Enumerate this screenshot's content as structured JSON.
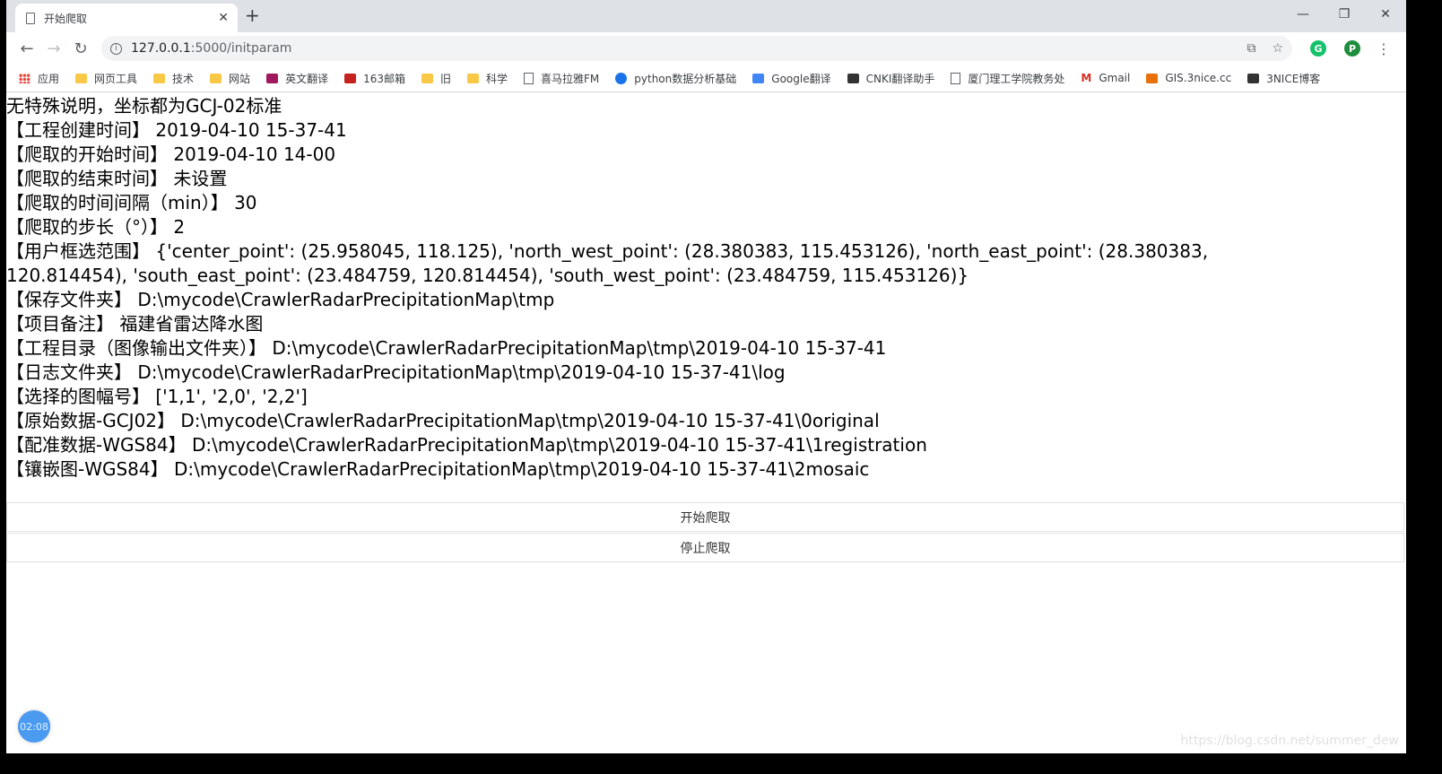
{
  "browser": {
    "tab_title": "开始爬取",
    "url_host": "127.0.0.1",
    "url_path": ":5000/initparam",
    "avatar_letter": "P",
    "ext_letter": "G"
  },
  "bookmarks": [
    {
      "label": "应用",
      "icon": "apps-icon"
    },
    {
      "label": "网页工具",
      "icon": "folder-icon"
    },
    {
      "label": "技术",
      "icon": "folder-icon"
    },
    {
      "label": "网站",
      "icon": "folder-icon"
    },
    {
      "label": "英文翻译",
      "icon": "translate-icon"
    },
    {
      "label": "163邮箱",
      "icon": "mail163-icon"
    },
    {
      "label": "旧",
      "icon": "folder-icon"
    },
    {
      "label": "科学",
      "icon": "folder-icon"
    },
    {
      "label": "喜马拉雅FM",
      "icon": "page-icon"
    },
    {
      "label": "python数据分析基础",
      "icon": "globe-icon"
    },
    {
      "label": "Google翻译",
      "icon": "google-translate-icon"
    },
    {
      "label": "CNKI翻译助手",
      "icon": "cnki-icon"
    },
    {
      "label": "厦门理工学院教务处",
      "icon": "page-icon"
    },
    {
      "label": "Gmail",
      "icon": "gmail-icon"
    },
    {
      "label": "GIS.3nice.cc",
      "icon": "gis-icon"
    },
    {
      "label": "3NICE博客",
      "icon": "blog-icon"
    }
  ],
  "info": {
    "note": "无特殊说明，坐标都为GCJ-02标准",
    "created": "【工程创建时间】 2019-04-10 15-37-41",
    "start": "【爬取的开始时间】 2019-04-10 14-00",
    "end": "【爬取的结束时间】 未设置",
    "interval": "【爬取的时间间隔（min）】 30",
    "step": "【爬取的步长（°）】 2",
    "extent": "【用户框选范围】 {'center_point': (25.958045, 118.125), 'north_west_point': (28.380383, 115.453126), 'north_east_point': (28.380383, 120.814454), 'south_east_point': (23.484759, 120.814454), 'south_west_point': (23.484759, 115.453126)}",
    "save_folder": "【保存文件夹】 D:\\mycode\\CrawlerRadarPrecipitationMap\\tmp",
    "remark": "【项目备注】 福建省雷达降水图",
    "project_dir": "【工程目录（图像输出文件夹）】 D:\\mycode\\CrawlerRadarPrecipitationMap\\tmp\\2019-04-10 15-37-41",
    "log_dir": "【日志文件夹】 D:\\mycode\\CrawlerRadarPrecipitationMap\\tmp\\2019-04-10 15-37-41\\log",
    "tiles": "【选择的图幅号】 ['1,1', '2,0', '2,2']",
    "original": "【原始数据-GCJ02】 D:\\mycode\\CrawlerRadarPrecipitationMap\\tmp\\2019-04-10 15-37-41\\0original",
    "registration": "【配准数据-WGS84】 D:\\mycode\\CrawlerRadarPrecipitationMap\\tmp\\2019-04-10 15-37-41\\1registration",
    "mosaic": "【镶嵌图-WGS84】 D:\\mycode\\CrawlerRadarPrecipitationMap\\tmp\\2019-04-10 15-37-41\\2mosaic"
  },
  "actions": {
    "start_label": "开始爬取",
    "stop_label": "停止爬取"
  },
  "overlay": {
    "timer": "02:08",
    "watermark": "https://blog.csdn.net/summer_dew"
  }
}
